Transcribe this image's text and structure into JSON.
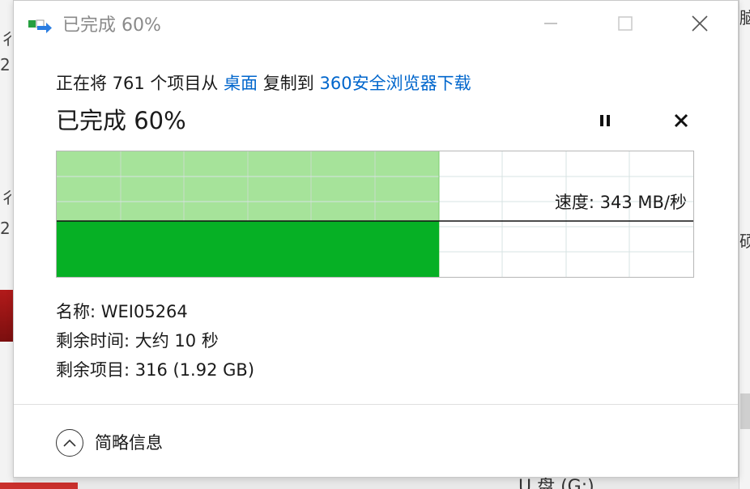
{
  "background": {
    "left_fragments": [
      "彳",
      "2",
      "彳",
      "2"
    ],
    "right_fragments": [
      "脑",
      "硕"
    ],
    "bottom_fragment": "U 盘 (G:)"
  },
  "window": {
    "title": "已完成 60%",
    "icon": "file-copy-icon",
    "buttons": {
      "minimize_icon": "minimize-icon",
      "maximize_icon": "maximize-icon",
      "close_icon": "close-icon"
    }
  },
  "copy": {
    "prefix": "正在将 761 个项目从",
    "source": "桌面",
    "middle": "复制到",
    "destination": "360安全浏览器下载"
  },
  "progress": {
    "heading": "已完成 60%",
    "percent": 60,
    "pause_icon": "pause-icon",
    "cancel_icon": "cancel-icon"
  },
  "graph": {
    "speed_label": "速度: 343 MB/秒",
    "speed_level": 0.55,
    "fill_color_light": "#a6e39a",
    "fill_color_dark": "#06b025",
    "grid_color": "#c8dcc8",
    "grid_color_empty": "#d7e3e3"
  },
  "details": {
    "name": "名称: WEI05264",
    "time_remaining": "剩余时间: 大约 10 秒",
    "items_remaining": "剩余项目: 316 (1.92 GB)"
  },
  "footer": {
    "toggle_label": "简略信息",
    "toggle_icon": "chevron-up-icon"
  }
}
